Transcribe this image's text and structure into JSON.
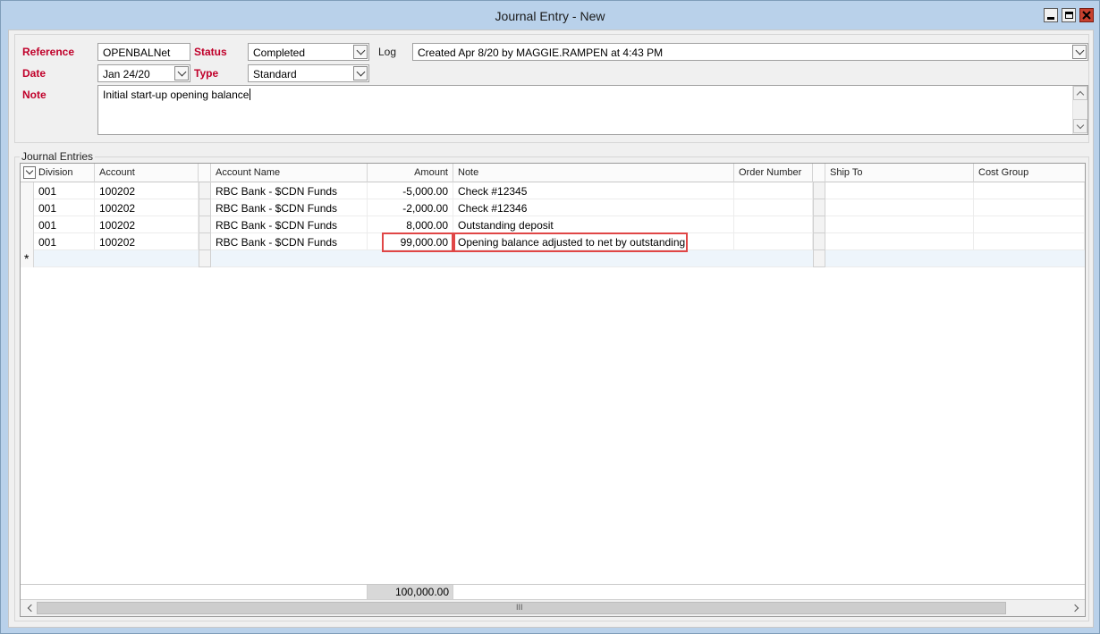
{
  "window": {
    "title": "Journal Entry - New"
  },
  "header": {
    "reference_label": "Reference",
    "reference_value": "OPENBALNet",
    "status_label": "Status",
    "status_value": "Completed",
    "log_label": "Log",
    "log_value": "Created Apr 8/20 by MAGGIE.RAMPEN at 4:43 PM",
    "date_label": "Date",
    "date_value": "Jan 24/20",
    "type_label": "Type",
    "type_value": "Standard",
    "note_label": "Note",
    "note_value": "Initial start-up opening balance"
  },
  "grid": {
    "group_label": "Journal Entries",
    "columns": [
      "Division",
      "Account",
      "Account Name",
      "Amount",
      "Note",
      "Order Number",
      "Ship To",
      "Cost Group"
    ],
    "rows": [
      {
        "division": "001",
        "account": "100202",
        "account_name": "RBC Bank -  $CDN Funds",
        "amount": "-5,000.00",
        "note": "Check #12345",
        "order_number": "",
        "ship_to": "",
        "cost_group": ""
      },
      {
        "division": "001",
        "account": "100202",
        "account_name": "RBC Bank -  $CDN Funds",
        "amount": "-2,000.00",
        "note": "Check #12346",
        "order_number": "",
        "ship_to": "",
        "cost_group": ""
      },
      {
        "division": "001",
        "account": "100202",
        "account_name": "RBC Bank -  $CDN Funds",
        "amount": "8,000.00",
        "note": "Outstanding deposit",
        "order_number": "",
        "ship_to": "",
        "cost_group": ""
      },
      {
        "division": "001",
        "account": "100202",
        "account_name": "RBC Bank -  $CDN Funds",
        "amount": "99,000.00",
        "note": "Opening balance adjusted to net by outstanding",
        "order_number": "",
        "ship_to": "",
        "cost_group": ""
      }
    ],
    "new_row_marker": "*",
    "total_amount": "100,000.00",
    "scroll_grip": "III"
  },
  "colors": {
    "label_red": "#c0002a",
    "highlight": "#e04646",
    "window_frame": "#b9d1ea"
  },
  "icons": [
    "minimize-icon",
    "maximize-icon",
    "close-icon",
    "chevron-down-icon",
    "scroll-up-icon",
    "scroll-down-icon",
    "scroll-left-icon",
    "scroll-right-icon"
  ]
}
